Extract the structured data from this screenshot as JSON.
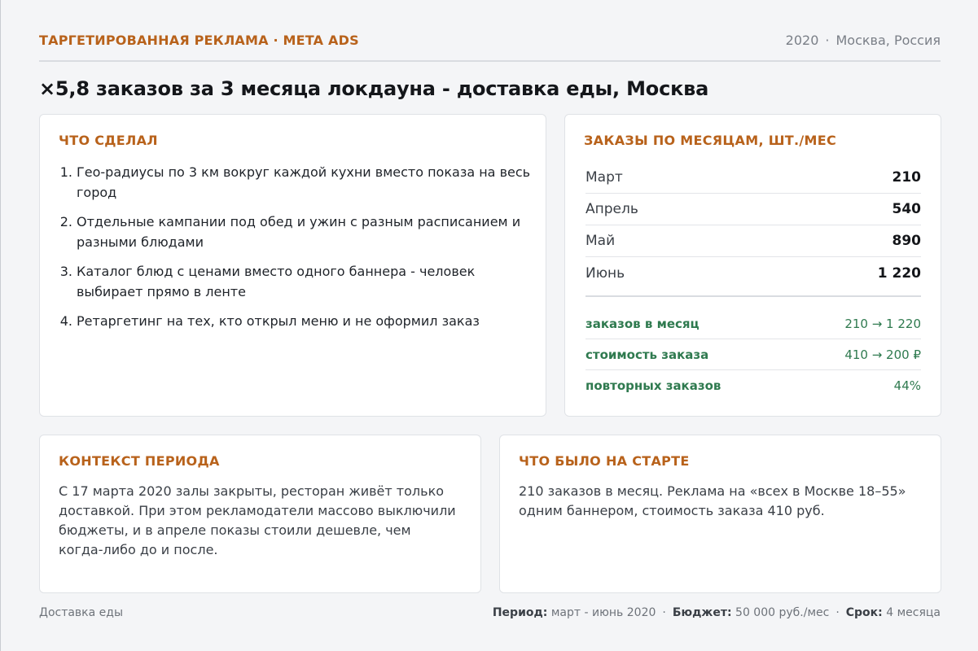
{
  "header": {
    "kicker": "ТАРГЕТИРОВАННАЯ РЕКЛАМА · META ADS",
    "year": "2020",
    "location": "Москва, Россия",
    "headline": "×5,8 заказов за 3 месяца локдауна - доставка еды, Москва"
  },
  "done": {
    "title": "ЧТО СДЕЛАЛ",
    "items": [
      {
        "num": "1.",
        "text": "Гео-радиусы по 3 км вокруг каждой кухни вместо показа на весь город"
      },
      {
        "num": "2.",
        "text": "Отдельные кампании под обед и ужин с разным расписанием и разными блюдами"
      },
      {
        "num": "3.",
        "text": "Каталог блюд с ценами вместо одного баннера - человек выбирает прямо в ленте"
      },
      {
        "num": "4.",
        "text": "Ретаргетинг на тех, кто открыл меню и не оформил заказ"
      }
    ]
  },
  "orders": {
    "title": "ЗАКАЗЫ ПО МЕСЯЦАМ, ШТ./МЕС",
    "months": [
      {
        "name": "Март",
        "value": "210"
      },
      {
        "name": "Апрель",
        "value": "540"
      },
      {
        "name": "Май",
        "value": "890"
      },
      {
        "name": "Июнь",
        "value": "1 220"
      }
    ],
    "kpis": [
      {
        "label": "заказов в месяц",
        "value": "210 → 1 220"
      },
      {
        "label": "стоимость заказа",
        "value": "410 → 200 ₽"
      },
      {
        "label": "повторных заказов",
        "value": "44%"
      }
    ]
  },
  "context": {
    "title": "КОНТЕКСТ ПЕРИОДА",
    "text": "С 17 марта 2020 залы закрыты, ресторан живёт только доставкой. При этом рекламодатели массово выключили бюджеты, и в апреле показы стоили дешевле, чем когда-либо до и после."
  },
  "start": {
    "title": "ЧТО БЫЛО НА СТАРТЕ",
    "text": "210 заказов в месяц. Реклама на «всех в Москве 18–55» одним баннером, стоимость заказа 410 руб."
  },
  "footer": {
    "category": "Доставка еды",
    "period_label": "Период:",
    "period_value": "март - июнь 2020",
    "budget_label": "Бюджет:",
    "budget_value": "50 000 руб./мес",
    "term_label": "Срок:",
    "term_value": "4 месяца"
  },
  "colors": {
    "accent": "#b8621b",
    "kpi_green": "#2f7a4f",
    "background": "#f4f5f7"
  }
}
